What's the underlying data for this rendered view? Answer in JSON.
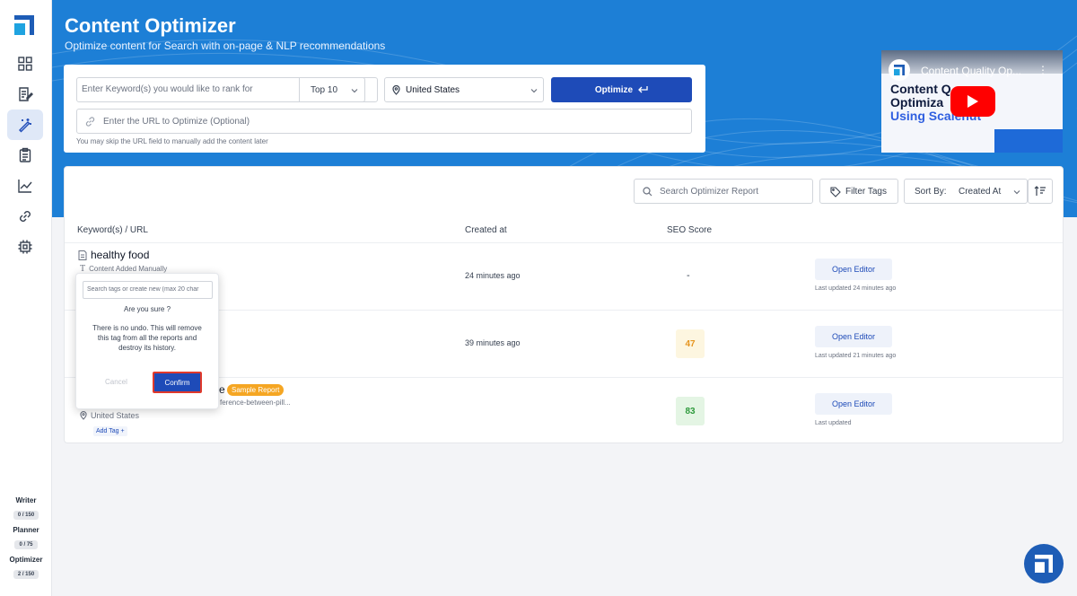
{
  "header": {
    "title": "Content Optimizer",
    "subtitle": "Optimize content for Search with on-page & NLP recommendations"
  },
  "form": {
    "keyword_placeholder": "Enter Keyword(s) you would like to rank for",
    "top_select": "Top 10",
    "country": "United States",
    "optimize_label": "Optimize",
    "url_placeholder": "Enter the URL to Optimize (Optional)",
    "hint": "You may skip the URL field to manually add the content later"
  },
  "video": {
    "title": "Content Quality Op...",
    "line1": "Content Q",
    "line2": "Optimiza",
    "line3": "Using Scalenut"
  },
  "toolbar": {
    "search_placeholder": "Search Optimizer Report",
    "filter_tags": "Filter Tags",
    "sort_by_label": "Sort By:",
    "sort_by_value": "Created At"
  },
  "table": {
    "headers": [
      "Keyword(s) / URL",
      "Created at",
      "SEO Score"
    ],
    "rows": [
      {
        "keyword": "healthy food",
        "sub": "Content Added Manually",
        "created": "24 minutes ago",
        "score": "-",
        "action": "Open Editor",
        "updated": "Last updated 24 minutes ago"
      },
      {
        "created": "39 minutes ago",
        "score": "47",
        "action": "Open Editor",
        "updated": "Last updated 21 minutes ago"
      },
      {
        "keyword_tail": "e",
        "badge": "Sample Report",
        "url_tail": "ference-between-pill...",
        "location": "United States",
        "add_tag": "Add Tag +",
        "score": "83",
        "action": "Open Editor",
        "updated": "Last updated"
      }
    ]
  },
  "popover": {
    "search_placeholder": "Search tags or create new (max 20 char",
    "question": "Are you sure ?",
    "message": "There is no undo. This will remove this tag from all the reports and destroy its history.",
    "cancel": "Cancel",
    "confirm": "Confirm"
  },
  "usage": [
    {
      "label": "Writer",
      "count": "0 / 150"
    },
    {
      "label": "Planner",
      "count": "0 / 75"
    },
    {
      "label": "Optimizer",
      "count": "2 / 150"
    }
  ],
  "colors": {
    "brand": "#1e4bb8",
    "hero": "#1d7fd6",
    "score_mid": "#e6951f",
    "score_good": "#2e9a3c"
  },
  "icons": {
    "sidebar": [
      "dashboard-icon",
      "document-edit-icon",
      "magic-wand-icon",
      "clipboard-icon",
      "chart-icon",
      "link-icon",
      "chip-icon"
    ]
  }
}
